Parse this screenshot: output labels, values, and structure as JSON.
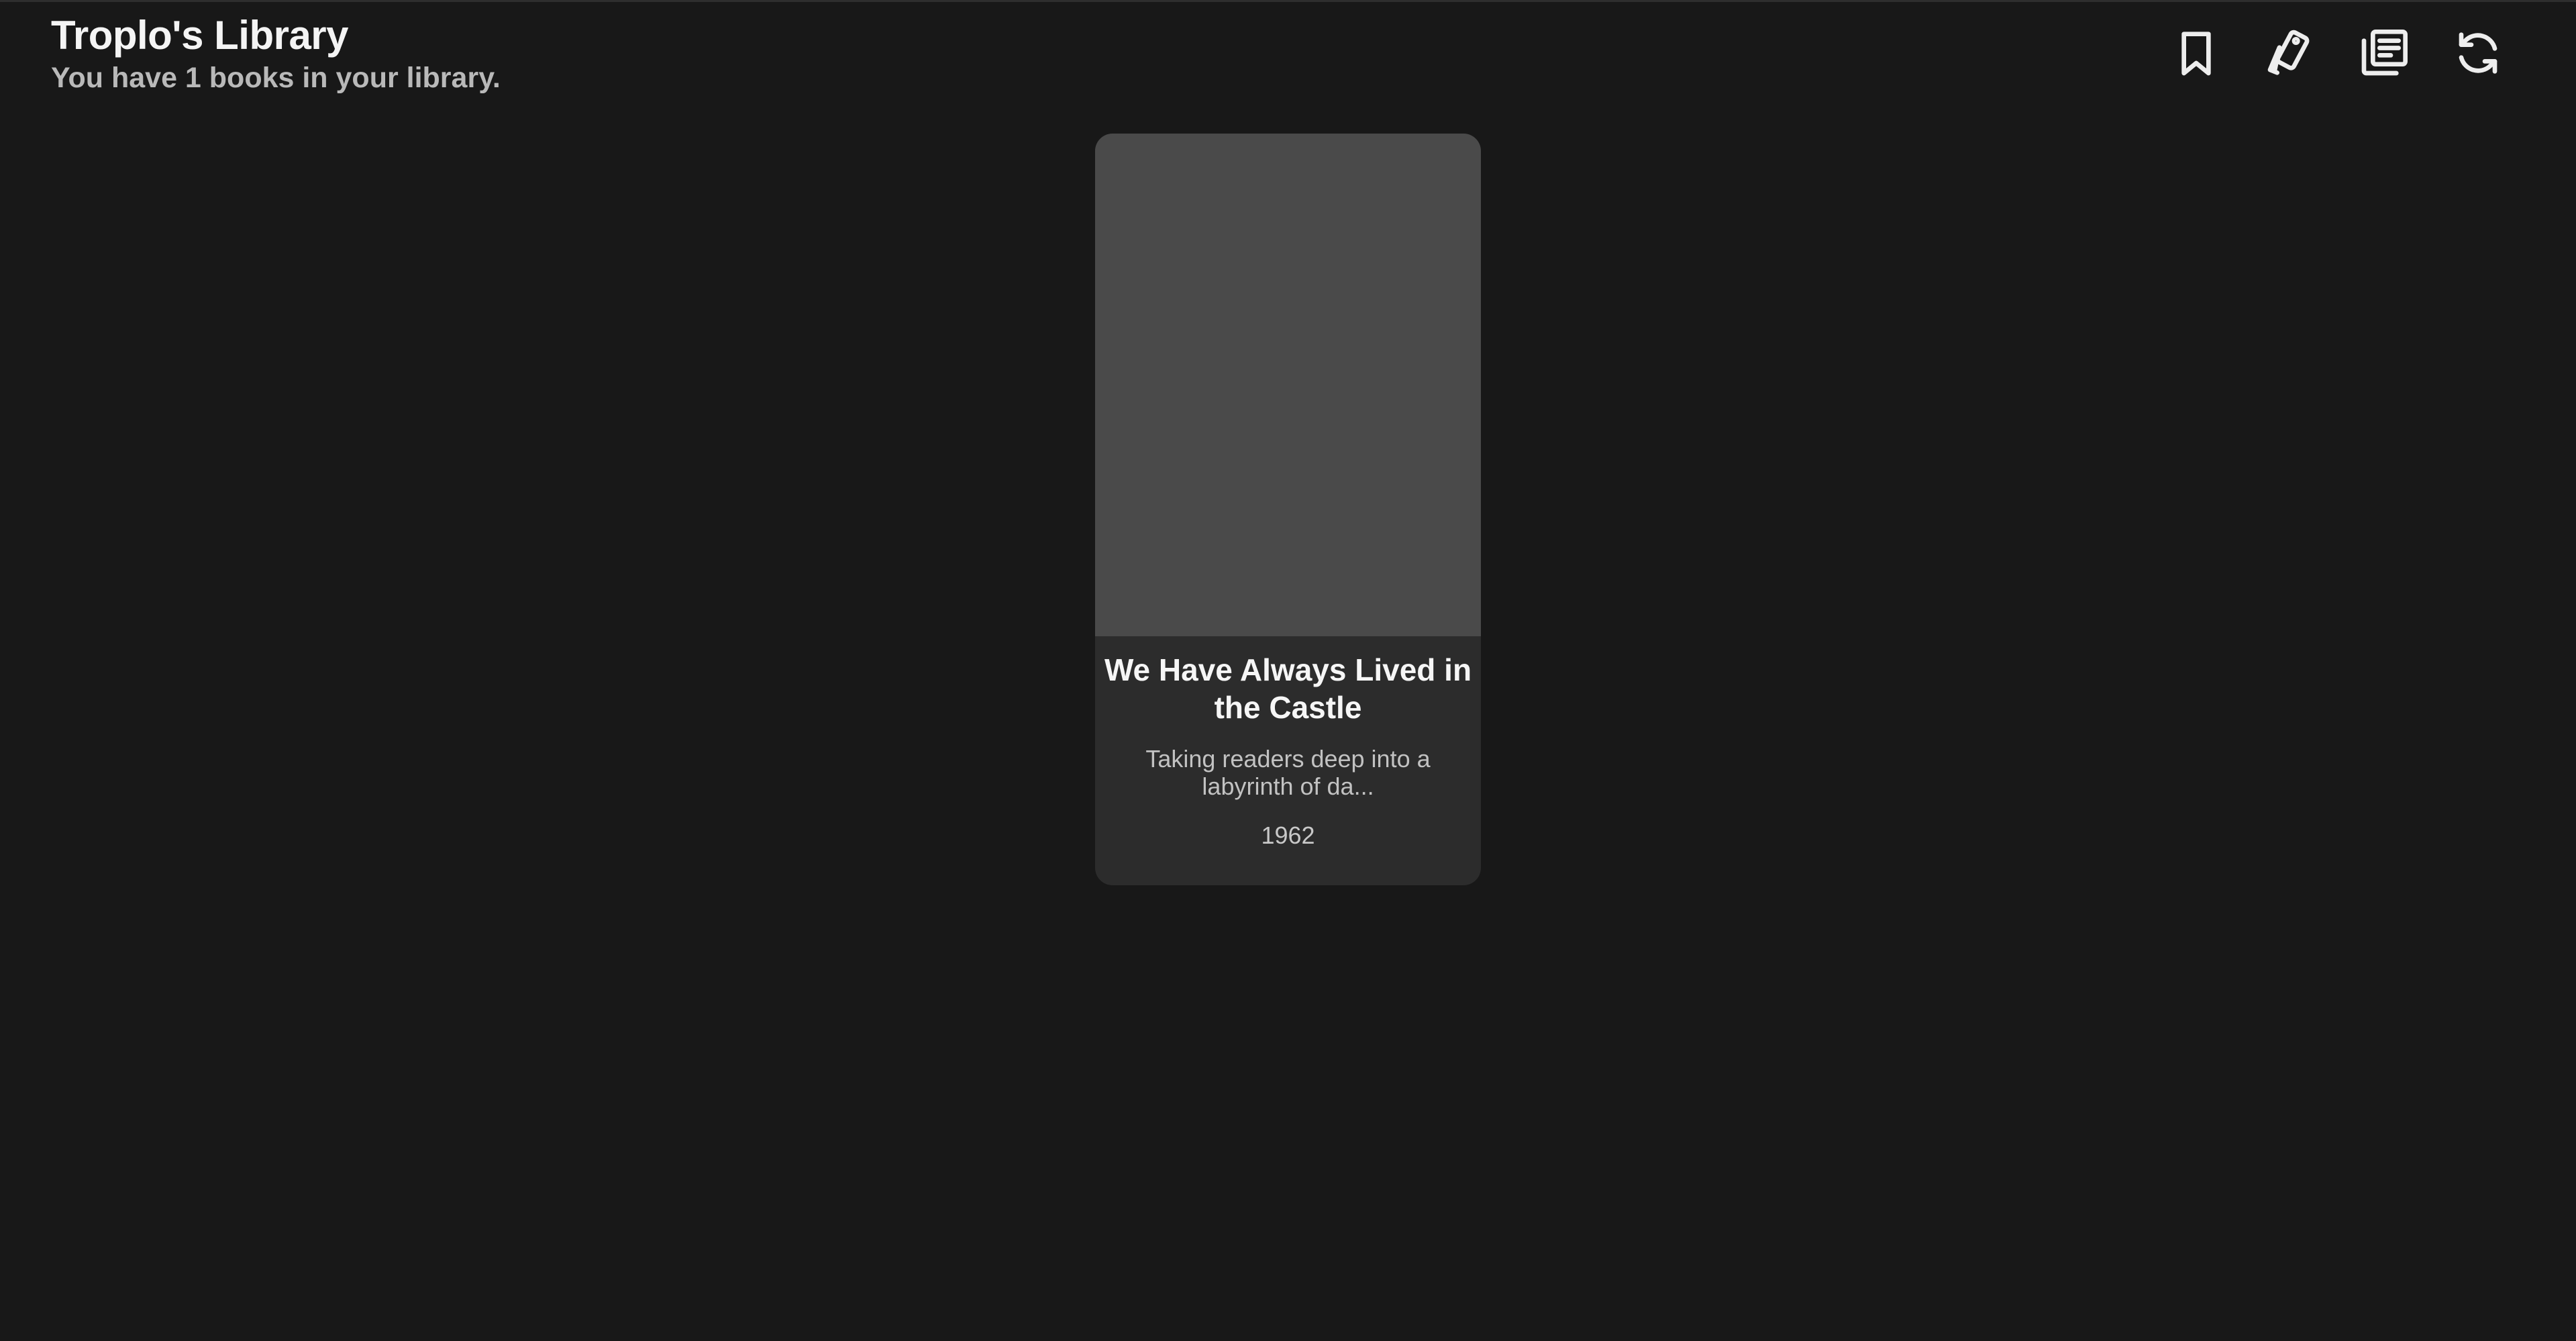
{
  "header": {
    "title": "Troplo's Library",
    "subtitle": "You have 1 books in your library."
  },
  "toolbar": {
    "buttons": [
      {
        "icon": "bookmark-icon"
      },
      {
        "icon": "tags-icon"
      },
      {
        "icon": "library-icon"
      },
      {
        "icon": "refresh-icon"
      }
    ]
  },
  "books": [
    {
      "title": "We Have Always Lived in the Castle",
      "description": "Taking readers deep into a labyrinth of da...",
      "year": "1962"
    }
  ],
  "colors": {
    "background": "#181818",
    "card": "#2c2c2c",
    "cover_placeholder": "#4a4a4a",
    "text_primary": "#f4f4f4",
    "text_secondary": "#b9b9b9"
  }
}
